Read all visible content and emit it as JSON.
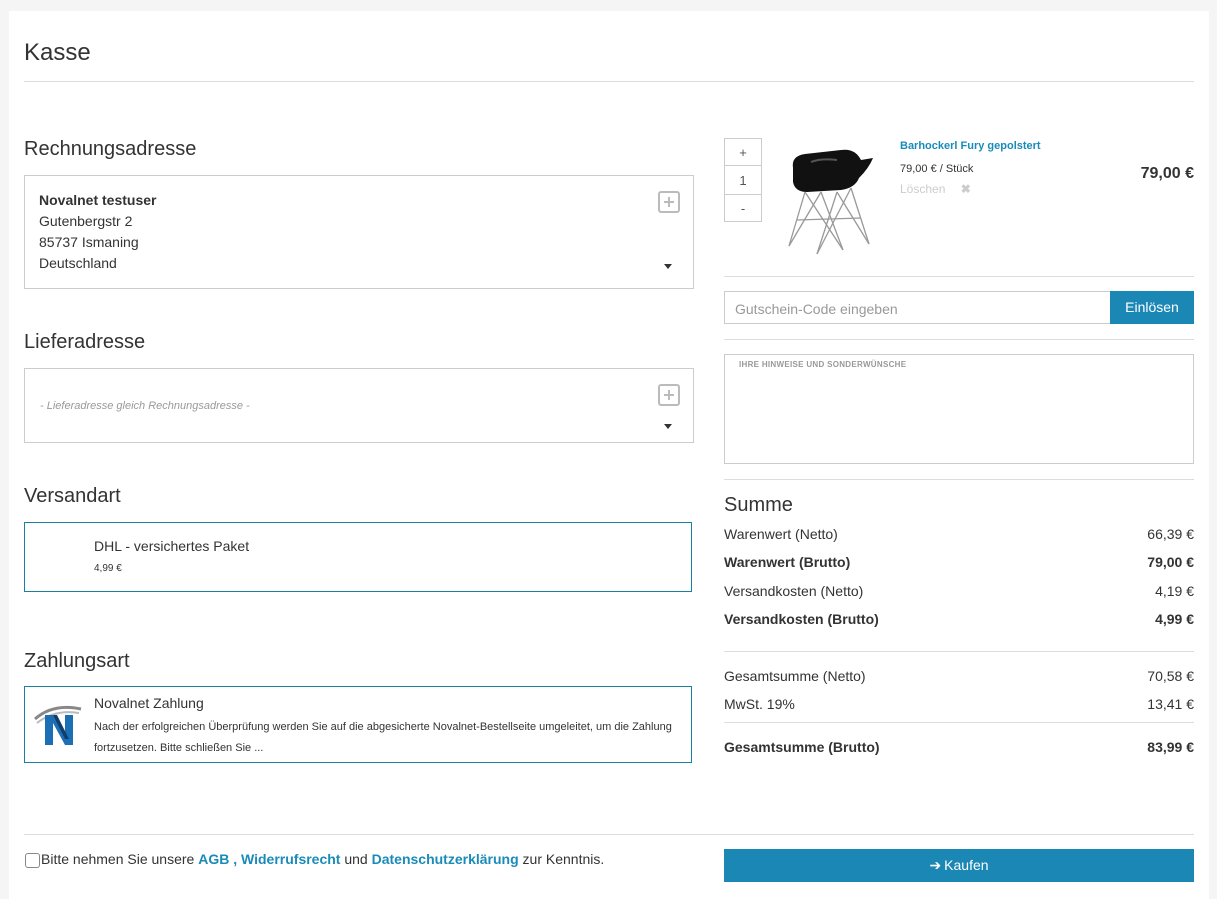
{
  "page": {
    "title": "Kasse"
  },
  "billing": {
    "heading": "Rechnungsadresse",
    "name": "Novalnet testuser",
    "street": "Gutenbergstr 2",
    "city": "85737 Ismaning",
    "country": "Deutschland"
  },
  "shipping_address": {
    "heading": "Lieferadresse",
    "placeholder": "- Lieferadresse gleich Rechnungsadresse -"
  },
  "shipping_method": {
    "heading": "Versandart",
    "name": "DHL - versichertes Paket",
    "price": "4,99 €"
  },
  "payment": {
    "heading": "Zahlungsart",
    "name": "Novalnet Zahlung",
    "description": "Nach der erfolgreichen Überprüfung werden Sie auf die abgesicherte Novalnet-Bestellseite umgeleitet, um die Zahlung fortzusetzen. Bitte schließen Sie ..."
  },
  "cart": {
    "qty_plus": "+",
    "qty_value": "1",
    "qty_minus": "-",
    "product_name": "Barhockerl Fury gepolstert",
    "unit_price": "79,00 € / Stück",
    "delete_label": "Löschen",
    "total": "79,00 €"
  },
  "voucher": {
    "placeholder": "Gutschein-Code eingeben",
    "button": "Einlösen"
  },
  "notes": {
    "label": "IHRE HINWEISE UND SONDERWÜNSCHE"
  },
  "summary": {
    "heading": "Summe",
    "rows": [
      {
        "label": "Warenwert (Netto)",
        "value": "66,39 €"
      },
      {
        "label": "Warenwert (Brutto)",
        "value": "79,00 €"
      },
      {
        "label": "Versandkosten (Netto)",
        "value": "4,19 €"
      },
      {
        "label": "Versandkosten (Brutto)",
        "value": "4,99 €"
      },
      {
        "label": "Gesamtsumme (Netto)",
        "value": "70,58 €"
      },
      {
        "label": "MwSt. 19%",
        "value": "13,41 €"
      },
      {
        "label": "Gesamtsumme (Brutto)",
        "value": "83,99 €"
      }
    ]
  },
  "terms": {
    "prefix": "Bitte nehmen Sie unsere",
    "agb": "AGB",
    "comma": ",",
    "widerruf": "Widerrufsrecht",
    "and": "und",
    "datenschutz": "Datenschutzerklärung",
    "suffix": "zur Kenntnis."
  },
  "buy_button": {
    "label": "Kaufen",
    "icon": "arrow-right-icon"
  },
  "colors": {
    "accent": "#1a87b5",
    "link": "#1a8bb9",
    "border_selected": "#1a80a0"
  }
}
